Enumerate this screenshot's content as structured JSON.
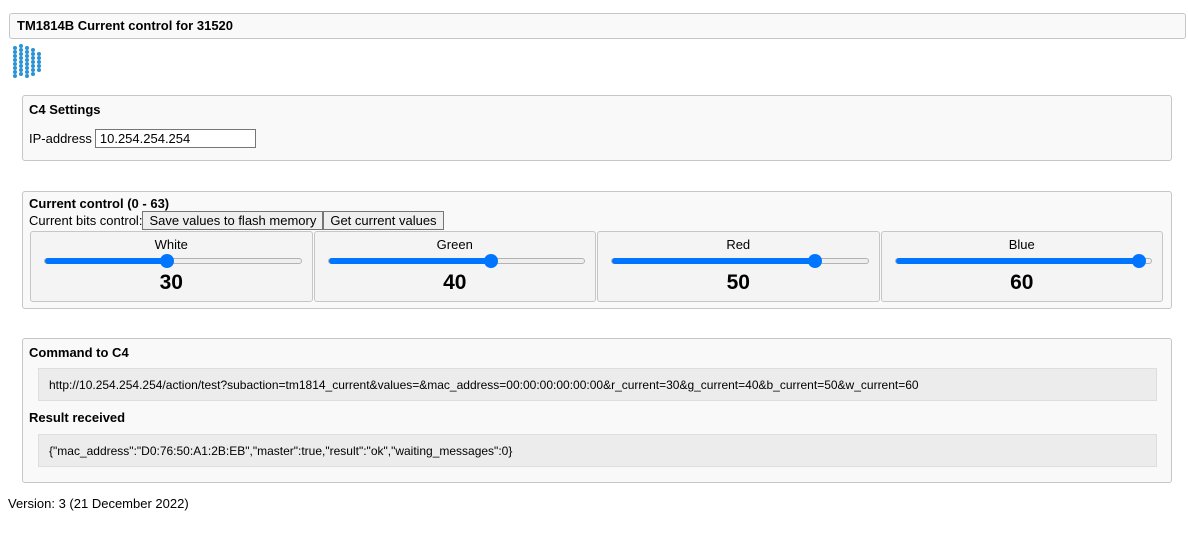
{
  "header": {
    "title": "TM1814B Current control for 31520"
  },
  "logo": {
    "icon": "dot-grid-logo-icon",
    "color": "#2a93d5"
  },
  "settings": {
    "title": "C4 Settings",
    "ip_label": "IP-address",
    "ip_value": "10.254.254.254"
  },
  "current": {
    "title": "Current control (0 - 63)",
    "bits_label": "Current bits control:",
    "save_button": "Save values to flash memory",
    "get_button": "Get current values",
    "max": 63,
    "accent": "#0075ff",
    "sliders": [
      {
        "name": "White",
        "value": 30
      },
      {
        "name": "Green",
        "value": 40
      },
      {
        "name": "Red",
        "value": 50
      },
      {
        "name": "Blue",
        "value": 60
      }
    ]
  },
  "command": {
    "title": "Command to C4",
    "url": "http://10.254.254.254/action/test?subaction=tm1814_current&values=&mac_address=00:00:00:00:00:00&r_current=30&g_current=40&b_current=50&w_current=60",
    "result_title": "Result received",
    "result": "{\"mac_address\":\"D0:76:50:A1:2B:EB\",\"master\":true,\"result\":\"ok\",\"waiting_messages\":0}"
  },
  "footer": {
    "version": "Version: 3 (21 December 2022)"
  }
}
